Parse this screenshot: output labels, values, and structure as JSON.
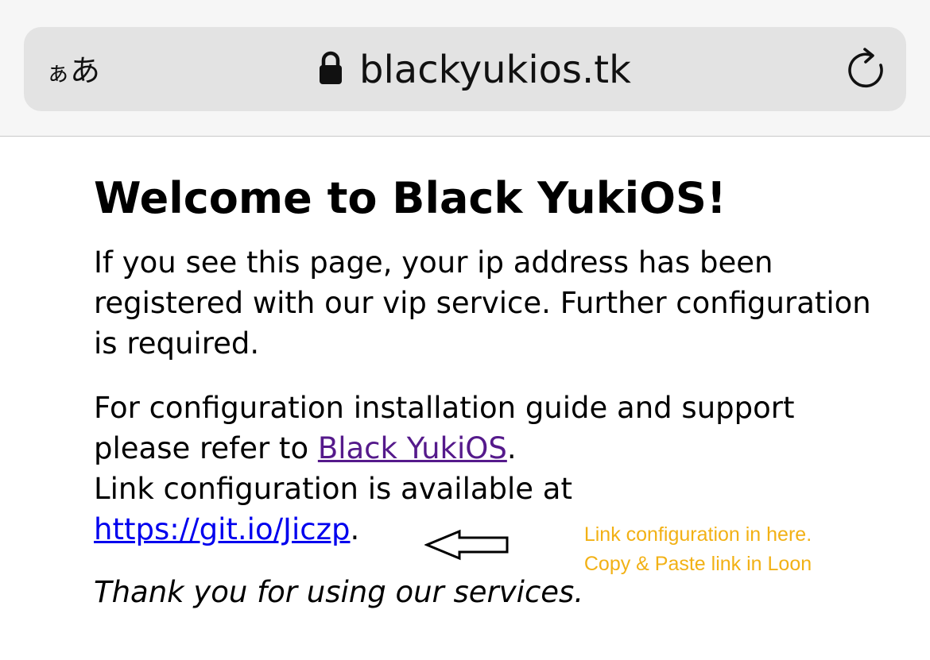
{
  "browser": {
    "text_size_label_small": "ぁ",
    "text_size_label": "あ",
    "domain": "blackyukios.tk"
  },
  "page": {
    "heading": "Welcome to Black YukiOS!",
    "paragraph1": "If you see this page, your ip address has been registered with our vip service. Further configuration is required.",
    "paragraph2_prefix": "For configuration installation guide and support please refer to ",
    "guide_link": "Black YukiOS",
    "paragraph2_mid": ".",
    "link_intro": "Link configuration is available at",
    "config_link": "https://git.io/Jiczp",
    "paragraph2_end": ".",
    "thanks": "Thank you for using our services."
  },
  "annotation": {
    "line1": "Link configuration in here.",
    "line2": "Copy & Paste link in Loon"
  },
  "colors": {
    "visited_link": "#551a8b",
    "link": "#0000ee",
    "annotation": "#f2b115"
  }
}
